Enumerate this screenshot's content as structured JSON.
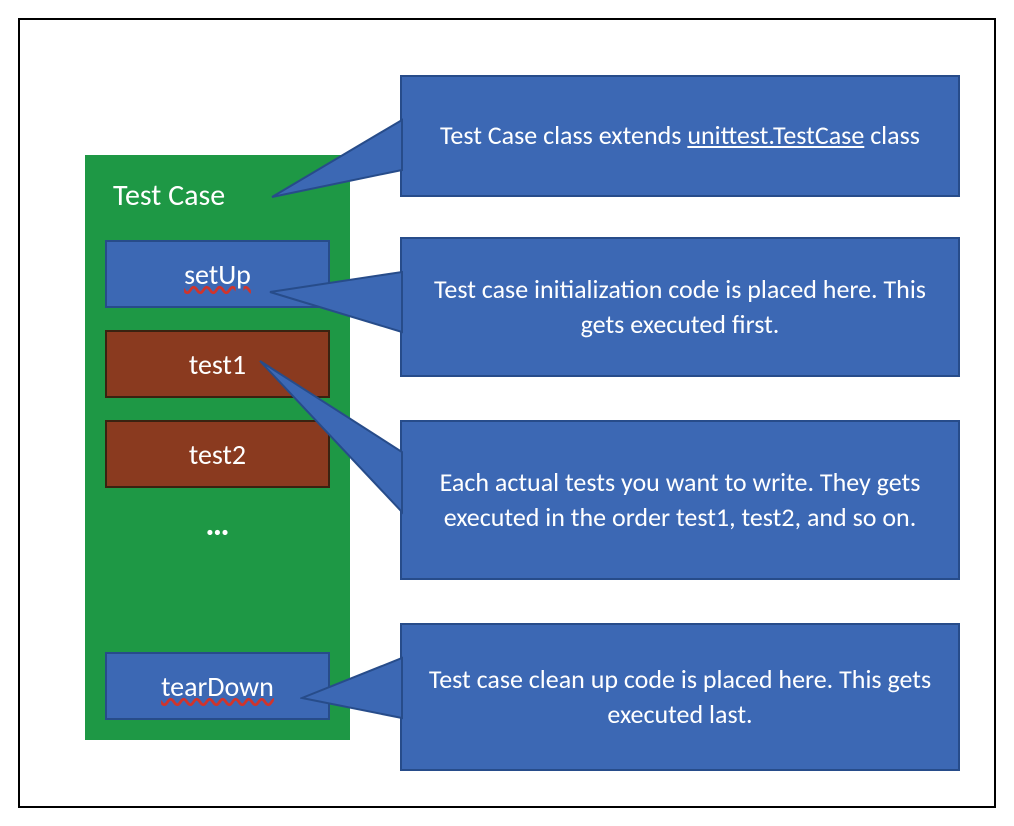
{
  "colors": {
    "green": "#1E9845",
    "blue": "#3C68B4",
    "blue_border": "#274C8A",
    "brown": "#8A3A1F"
  },
  "left": {
    "title": "Test Case",
    "setUp": "setUp",
    "test1": "test1",
    "test2": "test2",
    "dots": "…",
    "tearDown": "tearDown"
  },
  "callouts": {
    "cls": {
      "prefix": "Test Case class extends ",
      "underlined": "unittest.TestCase",
      "suffix": " class"
    },
    "setup": "Test case initialization code is placed here. This gets executed first.",
    "tests": "Each actual tests you want to write. They gets executed in the order test1, test2, and so on.",
    "teardown": "Test case clean up code is placed here. This gets executed last."
  }
}
